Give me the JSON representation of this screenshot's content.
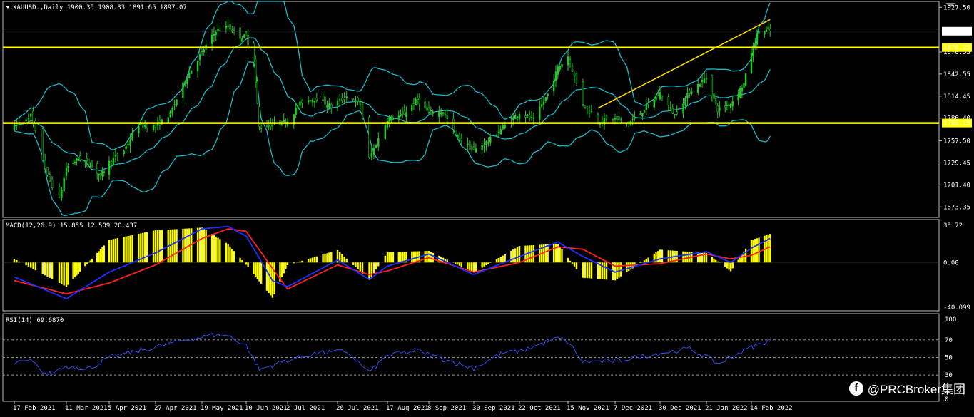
{
  "chart_data": [
    {
      "type": "candlestick",
      "title": "XAUUSD.,Daily",
      "ohlc_readout": "1900.35 1908.33 1891.65 1897.07",
      "ylim": [
        1660,
        1935
      ],
      "y_ticks": [
        "1927.50",
        "1897.07",
        "1876.25",
        "1870.55",
        "1842.55",
        "1814.45",
        "1786.40",
        "1780.15",
        "1757.50",
        "1729.45",
        "1701.40",
        "1673.35"
      ],
      "price_label": "1897.07",
      "horizontal_levels": [
        {
          "value": 1876.25,
          "label": "1876.25",
          "color": "#ffff00"
        },
        {
          "value": 1780.15,
          "label": "1780.15",
          "color": "#ffff00"
        }
      ],
      "current_price_line": 1897.07,
      "trendline": {
        "from": {
          "date": "29 Nov 2021",
          "price": 1799
        },
        "to": {
          "date": "24 Feb 2022",
          "price": 1912
        },
        "color": "#ffd700"
      },
      "indicators": [
        "Bollinger Bands (cyan)"
      ],
      "x_ticks": [
        "17 Feb 2021",
        "11 Mar 2021",
        "5 Apr 2021",
        "27 Apr 2021",
        "19 May 2021",
        "10 Jun 2021",
        "2 Jul 2021",
        "26 Jul 2021",
        "17 Aug 2021",
        "8 Sep 2021",
        "30 Sep 2021",
        "22 Oct 2021",
        "15 Nov 2021",
        "7 Dec 2021",
        "30 Dec 2021",
        "21 Jan 2022",
        "14 Feb 2022"
      ],
      "close_path": [
        [
          "17 Feb 2021",
          1776
        ],
        [
          "24 Feb 2021",
          1790
        ],
        [
          "3 Mar 2021",
          1712
        ],
        [
          "8 Mar 2021",
          1683
        ],
        [
          "11 Mar 2021",
          1723
        ],
        [
          "18 Mar 2021",
          1735
        ],
        [
          "25 Mar 2021",
          1728
        ],
        [
          "31 Mar 2021",
          1713
        ],
        [
          "5 Apr 2021",
          1730
        ],
        [
          "12 Apr 2021",
          1745
        ],
        [
          "19 Apr 2021",
          1778
        ],
        [
          "27 Apr 2021",
          1775
        ],
        [
          "4 May 2021",
          1792
        ],
        [
          "11 May 2021",
          1835
        ],
        [
          "19 May 2021",
          1870
        ],
        [
          "26 May 2021",
          1898
        ],
        [
          "1 Jun 2021",
          1903
        ],
        [
          "7 Jun 2021",
          1890
        ],
        [
          "10 Jun 2021",
          1890
        ],
        [
          "14 Jun 2021",
          1860
        ],
        [
          "17 Jun 2021",
          1775
        ],
        [
          "24 Jun 2021",
          1778
        ],
        [
          "2 Jul 2021",
          1783
        ],
        [
          "9 Jul 2021",
          1808
        ],
        [
          "16 Jul 2021",
          1812
        ],
        [
          "23 Jul 2021",
          1801
        ],
        [
          "30 Jul 2021",
          1814
        ],
        [
          "5 Aug 2021",
          1804
        ],
        [
          "9 Aug 2021",
          1735
        ],
        [
          "17 Aug 2021",
          1785
        ],
        [
          "25 Aug 2021",
          1790
        ],
        [
          "2 Sep 2021",
          1810
        ],
        [
          "8 Sep 2021",
          1793
        ],
        [
          "15 Sep 2021",
          1795
        ],
        [
          "21 Sep 2021",
          1765
        ],
        [
          "30 Sep 2021",
          1745
        ],
        [
          "7 Oct 2021",
          1757
        ],
        [
          "14 Oct 2021",
          1775
        ],
        [
          "22 Oct 2021",
          1793
        ],
        [
          "29 Oct 2021",
          1784
        ],
        [
          "5 Nov 2021",
          1817
        ],
        [
          "10 Nov 2021",
          1850
        ],
        [
          "15 Nov 2021",
          1865
        ],
        [
          "22 Nov 2021",
          1805
        ],
        [
          "29 Nov 2021",
          1783
        ],
        [
          "7 Dec 2021",
          1785
        ],
        [
          "14 Dec 2021",
          1780
        ],
        [
          "21 Dec 2021",
          1795
        ],
        [
          "30 Dec 2021",
          1818
        ],
        [
          "6 Jan 2022",
          1790
        ],
        [
          "13 Jan 2022",
          1820
        ],
        [
          "21 Jan 2022",
          1838
        ],
        [
          "27 Jan 2022",
          1797
        ],
        [
          "3 Feb 2022",
          1805
        ],
        [
          "10 Feb 2022",
          1830
        ],
        [
          "14 Feb 2022",
          1870
        ],
        [
          "18 Feb 2022",
          1898
        ],
        [
          "24 Feb 2022",
          1897
        ]
      ]
    },
    {
      "type": "bar",
      "title": "MACD(12,26,9) 15.855 12.509 20.437",
      "ylim": [
        -40.099,
        35.72
      ],
      "y_ticks": [
        "35.72",
        "0.00",
        "-40.099"
      ],
      "series": [
        {
          "name": "MACD histogram",
          "color": "#ffff00"
        },
        {
          "name": "MACD line",
          "color": "#1f2fff"
        },
        {
          "name": "Signal line",
          "color": "#ff2020"
        }
      ],
      "macd_path": [
        [
          "17 Feb 2021",
          -12
        ],
        [
          "11 Mar 2021",
          -30
        ],
        [
          "5 Apr 2021",
          -8
        ],
        [
          "27 Apr 2021",
          8
        ],
        [
          "19 May 2021",
          28
        ],
        [
          "1 Jun 2021",
          30
        ],
        [
          "10 Jun 2021",
          22
        ],
        [
          "24 Jun 2021",
          -15
        ],
        [
          "2 Jul 2021",
          -20
        ],
        [
          "26 Jul 2021",
          2
        ],
        [
          "9 Aug 2021",
          -14
        ],
        [
          "17 Aug 2021",
          -3
        ],
        [
          "8 Sep 2021",
          7
        ],
        [
          "30 Sep 2021",
          -10
        ],
        [
          "22 Oct 2021",
          5
        ],
        [
          "10 Nov 2021",
          17
        ],
        [
          "22 Nov 2021",
          5
        ],
        [
          "7 Dec 2021",
          -8
        ],
        [
          "30 Dec 2021",
          3
        ],
        [
          "21 Jan 2022",
          9
        ],
        [
          "3 Feb 2022",
          0
        ],
        [
          "14 Feb 2022",
          12
        ],
        [
          "24 Feb 2022",
          20
        ]
      ],
      "signal_path": [
        [
          "17 Feb 2021",
          -15
        ],
        [
          "11 Mar 2021",
          -26
        ],
        [
          "5 Apr 2021",
          -17
        ],
        [
          "27 Apr 2021",
          -2
        ],
        [
          "19 May 2021",
          20
        ],
        [
          "1 Jun 2021",
          28
        ],
        [
          "10 Jun 2021",
          26
        ],
        [
          "24 Jun 2021",
          -5
        ],
        [
          "2 Jul 2021",
          -22
        ],
        [
          "26 Jul 2021",
          -2
        ],
        [
          "9 Aug 2021",
          -10
        ],
        [
          "17 Aug 2021",
          -7
        ],
        [
          "8 Sep 2021",
          4
        ],
        [
          "30 Sep 2021",
          -8
        ],
        [
          "22 Oct 2021",
          0
        ],
        [
          "10 Nov 2021",
          13
        ],
        [
          "22 Nov 2021",
          11
        ],
        [
          "7 Dec 2021",
          -3
        ],
        [
          "30 Dec 2021",
          -1
        ],
        [
          "21 Jan 2022",
          7
        ],
        [
          "3 Feb 2022",
          3
        ],
        [
          "14 Feb 2022",
          6
        ],
        [
          "24 Feb 2022",
          13
        ]
      ]
    },
    {
      "type": "line",
      "title": "RSI(14) 69.6870",
      "ylim": [
        0,
        100
      ],
      "y_ticks": [
        "100",
        "70",
        "50",
        "30",
        "0"
      ],
      "reference_levels": [
        70,
        50,
        30
      ],
      "series": [
        {
          "name": "RSI(14)",
          "color": "#3355ff"
        }
      ],
      "rsi_path": [
        [
          "17 Feb 2021",
          43
        ],
        [
          "24 Feb 2021",
          46
        ],
        [
          "3 Mar 2021",
          30
        ],
        [
          "11 Mar 2021",
          40
        ],
        [
          "25 Mar 2021",
          38
        ],
        [
          "5 Apr 2021",
          50
        ],
        [
          "27 Apr 2021",
          62
        ],
        [
          "11 May 2021",
          70
        ],
        [
          "26 May 2021",
          76
        ],
        [
          "1 Jun 2021",
          75
        ],
        [
          "10 Jun 2021",
          64
        ],
        [
          "17 Jun 2021",
          36
        ],
        [
          "2 Jul 2021",
          47
        ],
        [
          "16 Jul 2021",
          55
        ],
        [
          "30 Jul 2021",
          57
        ],
        [
          "9 Aug 2021",
          33
        ],
        [
          "17 Aug 2021",
          52
        ],
        [
          "2 Sep 2021",
          58
        ],
        [
          "15 Sep 2021",
          48
        ],
        [
          "30 Sep 2021",
          38
        ],
        [
          "14 Oct 2021",
          55
        ],
        [
          "22 Oct 2021",
          57
        ],
        [
          "10 Nov 2021",
          72
        ],
        [
          "15 Nov 2021",
          68
        ],
        [
          "22 Nov 2021",
          45
        ],
        [
          "7 Dec 2021",
          46
        ],
        [
          "30 Dec 2021",
          55
        ],
        [
          "13 Jan 2022",
          60
        ],
        [
          "27 Jan 2022",
          43
        ],
        [
          "10 Feb 2022",
          58
        ],
        [
          "24 Feb 2022",
          70
        ]
      ]
    }
  ],
  "watermark": {
    "icon": "facebook-icon",
    "text": "@PRCBroker集团"
  }
}
